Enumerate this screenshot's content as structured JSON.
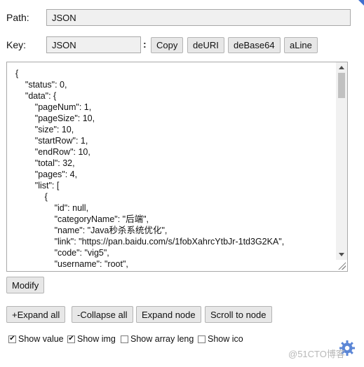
{
  "path": {
    "label": "Path:",
    "value": "JSON"
  },
  "key": {
    "label": "Key:",
    "value": "JSON",
    "separator": ":"
  },
  "toolbar": {
    "copy": "Copy",
    "deuri": "deURI",
    "debase64": "deBase64",
    "aline": "aLine"
  },
  "editor": {
    "lines": [
      "{",
      "    \"status\": 0,",
      "    \"data\": {",
      "        \"pageNum\": 1,",
      "        \"pageSize\": 10,",
      "        \"size\": 10,",
      "        \"startRow\": 1,",
      "        \"endRow\": 10,",
      "        \"total\": 32,",
      "        \"pages\": 4,",
      "        \"list\": [",
      "            {",
      "                \"id\": null,",
      "                \"categoryName\": \"后端\",",
      "                \"name\": \"Java秒杀系统优化\",",
      "                \"link\": \"https://pan.baidu.com/s/1fobXahrcYtbJr-1td3G2KA\",",
      "                \"code\": \"vig5\",",
      "                \"username\": \"root\","
    ]
  },
  "modify_label": "Modify",
  "actions": {
    "expand_all": "+Expand all",
    "collapse_all": "-Collapse all",
    "expand_node": "Expand node",
    "scroll_to_node": "Scroll to node"
  },
  "options": [
    {
      "label": "Show value",
      "checked": true
    },
    {
      "label": "Show img",
      "checked": true
    },
    {
      "label": "Show array leng",
      "checked": false
    },
    {
      "label": "Show ico",
      "checked": false
    }
  ],
  "settings_icon": "gear-icon",
  "watermark": "@51CTO博客"
}
